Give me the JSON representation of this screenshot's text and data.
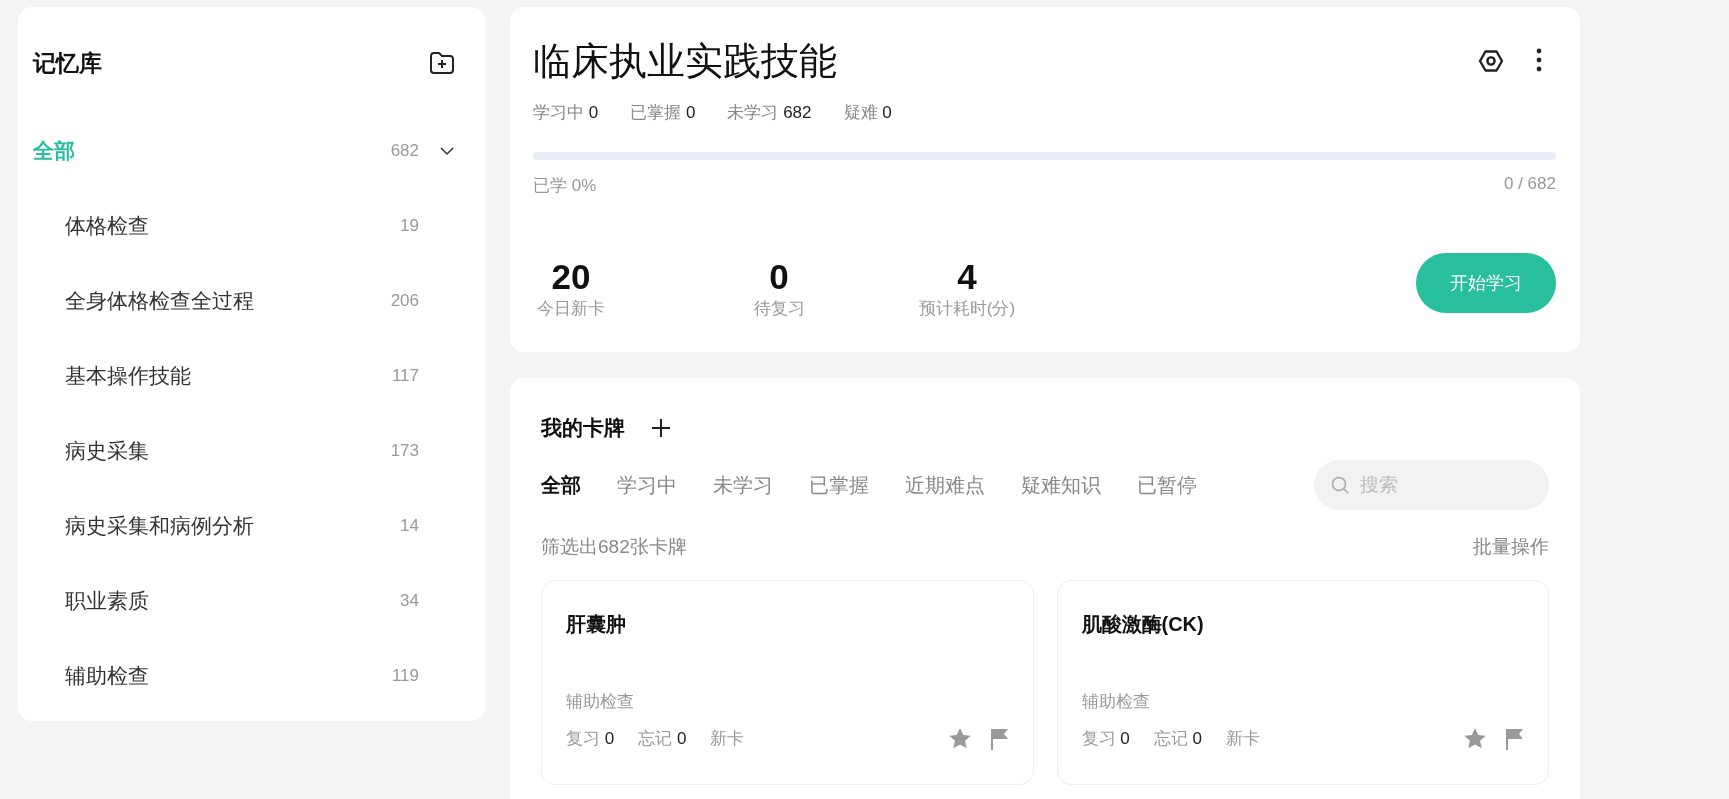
{
  "sidebar": {
    "title": "记忆库",
    "tree": [
      {
        "label": "全部",
        "count": "682",
        "selected": true,
        "expanded": true,
        "children": [
          {
            "label": "体格检查",
            "count": "19",
            "selected": false
          },
          {
            "label": "全身体格检查全过程",
            "count": "206",
            "selected": false
          },
          {
            "label": "基本操作技能",
            "count": "117",
            "selected": false
          },
          {
            "label": "病史采集",
            "count": "173",
            "selected": false
          },
          {
            "label": "病史采集和病例分析",
            "count": "14",
            "selected": false
          },
          {
            "label": "职业素质",
            "count": "34",
            "selected": false
          },
          {
            "label": "辅助检查",
            "count": "119",
            "selected": false
          }
        ]
      }
    ]
  },
  "deck": {
    "title": "临床执业实践技能",
    "stats": [
      {
        "label": "学习中",
        "value": "0"
      },
      {
        "label": "已掌握",
        "value": "0"
      },
      {
        "label": "未学习",
        "value": "682"
      },
      {
        "label": "疑难",
        "value": "0"
      }
    ],
    "progress": {
      "level": 0,
      "label": "已学 0%",
      "reading": "0 / 682"
    },
    "metrics": [
      {
        "value": "20",
        "label": "今日新卡"
      },
      {
        "value": "0",
        "label": "待复习"
      },
      {
        "value": "4",
        "label": "预计耗时(分)"
      }
    ],
    "start_button": "开始学习"
  },
  "cards_panel": {
    "title": "我的卡牌",
    "tabs": [
      {
        "label": "全部",
        "selected": true
      },
      {
        "label": "学习中",
        "selected": false
      },
      {
        "label": "未学习",
        "selected": false
      },
      {
        "label": "已掌握",
        "selected": false
      },
      {
        "label": "近期难点",
        "selected": false
      },
      {
        "label": "疑难知识",
        "selected": false
      },
      {
        "label": "已暂停",
        "selected": false
      }
    ],
    "search": {
      "placeholder": "搜索"
    },
    "filter_summary": "筛选出682张卡牌",
    "batch_action": "批量操作",
    "cards": [
      {
        "title": "肝囊肿",
        "category": "辅助检查",
        "stats": [
          {
            "label": "复习",
            "value": "0"
          },
          {
            "label": "忘记",
            "value": "0"
          },
          {
            "label": "新卡"
          }
        ]
      },
      {
        "title": "肌酸激酶(CK)",
        "category": "辅助检查",
        "stats": [
          {
            "label": "复习",
            "value": "0"
          },
          {
            "label": "忘记",
            "value": "0"
          },
          {
            "label": "新卡"
          }
        ]
      }
    ]
  }
}
